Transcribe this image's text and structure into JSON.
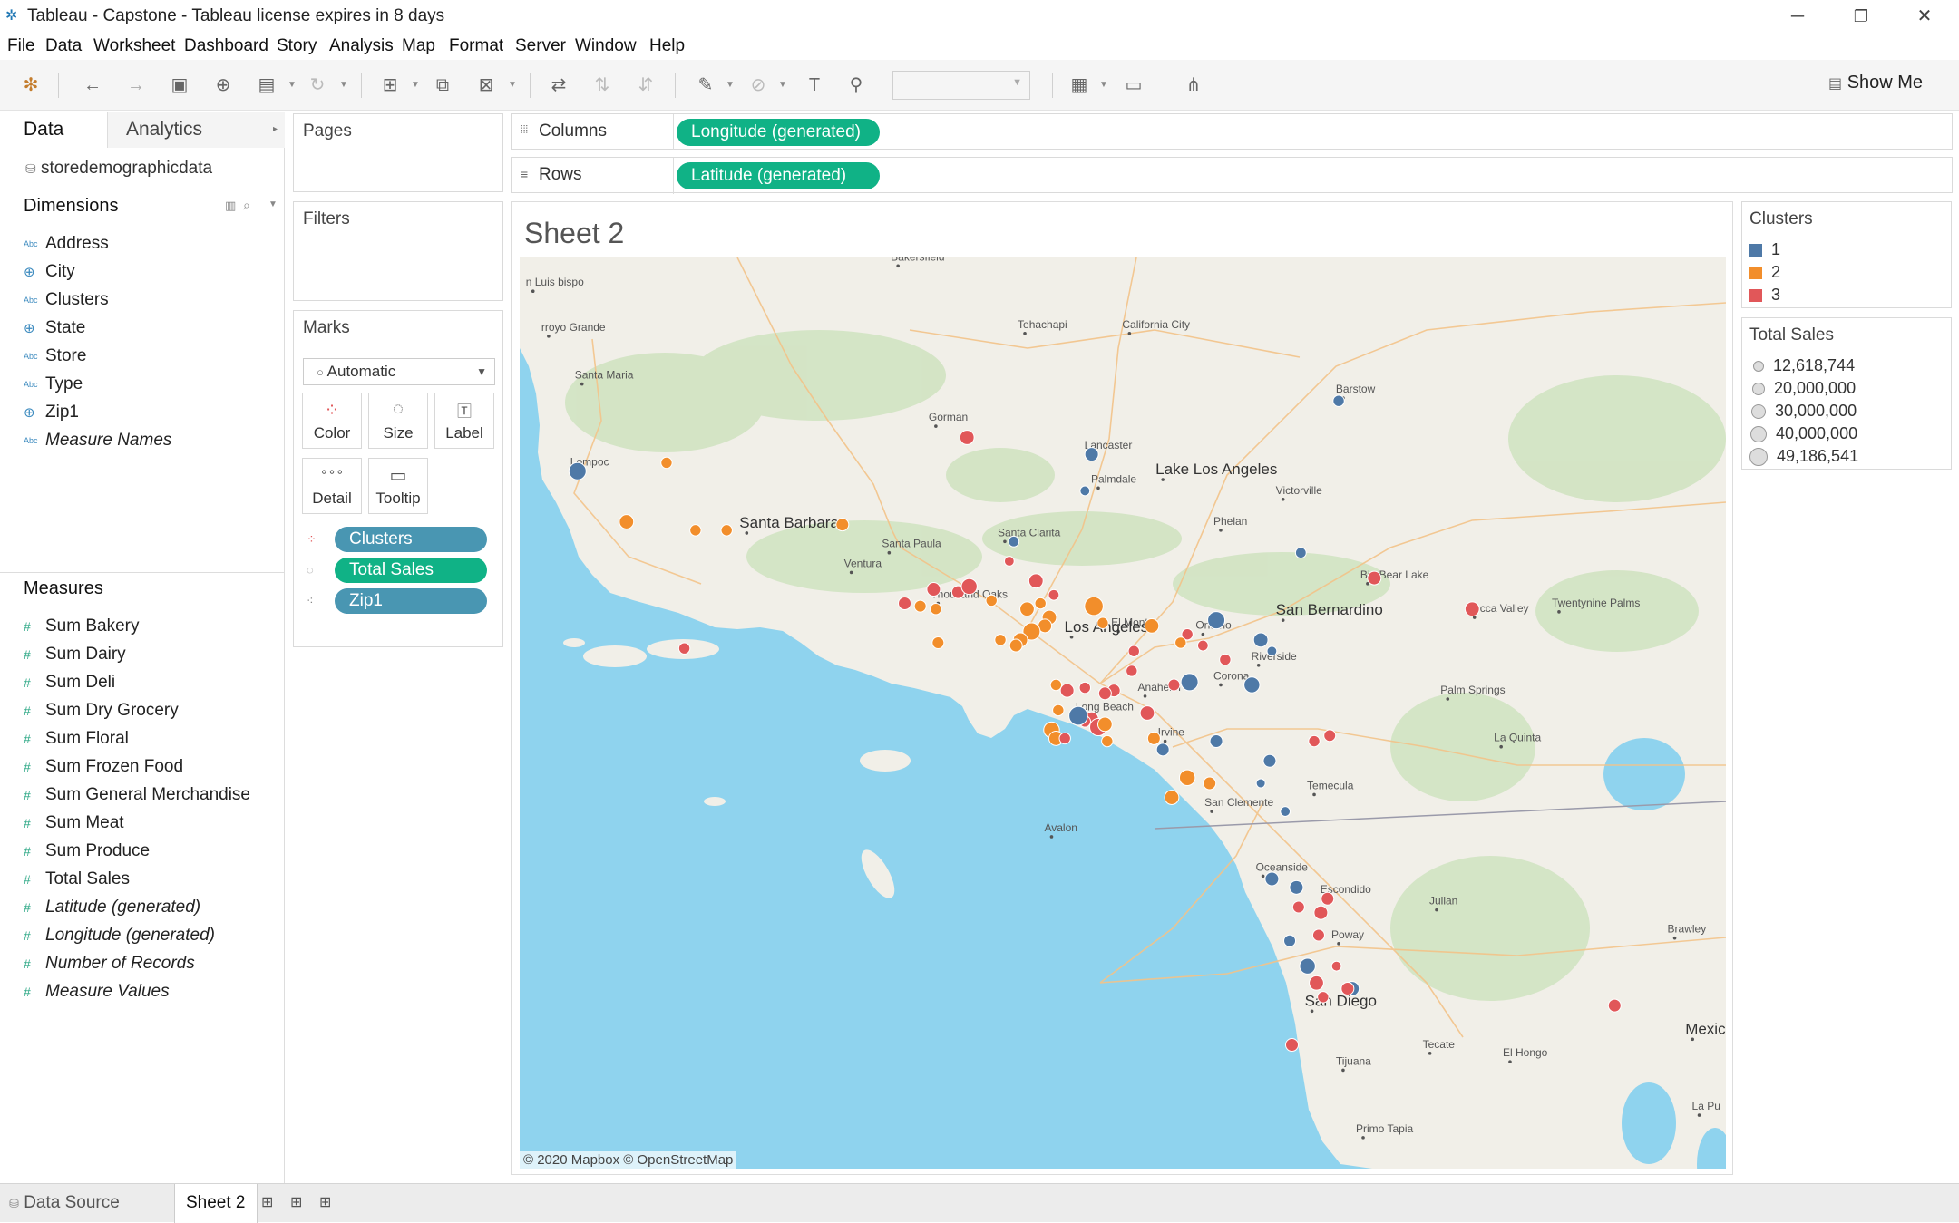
{
  "window": {
    "title": "Tableau - Capstone - Tableau license expires in 8 days",
    "minimize": "─",
    "restore": "❐",
    "close": "✕"
  },
  "menu": [
    "File",
    "Data",
    "Worksheet",
    "Dashboard",
    "Story",
    "Analysis",
    "Map",
    "Format",
    "Server",
    "Window",
    "Help"
  ],
  "toolbar": {
    "show_me": "Show Me"
  },
  "data_pane": {
    "tabs": {
      "data": "Data",
      "analytics": "Analytics"
    },
    "datasource": "storedemographicdata",
    "dimensions_title": "Dimensions",
    "dimensions": [
      {
        "name": "Address",
        "type": "abc",
        "italic": false
      },
      {
        "name": "City",
        "type": "geo",
        "italic": false
      },
      {
        "name": "Clusters",
        "type": "abc",
        "italic": false
      },
      {
        "name": "State",
        "type": "geo",
        "italic": false
      },
      {
        "name": "Store",
        "type": "abc",
        "italic": false
      },
      {
        "name": "Type",
        "type": "abc",
        "italic": false
      },
      {
        "name": "Zip1",
        "type": "geo",
        "italic": false
      },
      {
        "name": "Measure Names",
        "type": "abc",
        "italic": true
      }
    ],
    "measures_title": "Measures",
    "measures": [
      {
        "name": "Sum Bakery",
        "italic": false
      },
      {
        "name": "Sum Dairy",
        "italic": false
      },
      {
        "name": "Sum Deli",
        "italic": false
      },
      {
        "name": "Sum Dry Grocery",
        "italic": false
      },
      {
        "name": "Sum Floral",
        "italic": false
      },
      {
        "name": "Sum Frozen Food",
        "italic": false
      },
      {
        "name": "Sum General Merchandise",
        "italic": false
      },
      {
        "name": "Sum Meat",
        "italic": false
      },
      {
        "name": "Sum Produce",
        "italic": false
      },
      {
        "name": "Total Sales",
        "italic": false
      },
      {
        "name": "Latitude (generated)",
        "italic": true
      },
      {
        "name": "Longitude (generated)",
        "italic": true
      },
      {
        "name": "Number of Records",
        "italic": true
      },
      {
        "name": "Measure Values",
        "italic": true
      }
    ]
  },
  "cards": {
    "pages": "Pages",
    "filters": "Filters",
    "marks": "Marks",
    "mark_type": "Automatic",
    "mark_buttons": [
      "Color",
      "Size",
      "Label",
      "Detail",
      "Tooltip"
    ],
    "mark_pills": [
      "Clusters",
      "Total Sales",
      "Zip1"
    ]
  },
  "shelves": {
    "columns_label": "Columns",
    "columns_pill": "Longitude (generated)",
    "rows_label": "Rows",
    "rows_pill": "Latitude (generated)"
  },
  "sheet": {
    "title": "Sheet 2"
  },
  "map": {
    "attribution": "© 2020 Mapbox © OpenStreetMap",
    "ocean_color": "#8fd3ee",
    "land_color": "#f1efe8",
    "places": [
      {
        "name": "Bakersfield",
        "lon": -119.02,
        "lat": 35.37
      },
      {
        "name": "Tehachapi",
        "lon": -118.45,
        "lat": 35.13
      },
      {
        "name": "California City",
        "lon": -117.98,
        "lat": 35.13
      },
      {
        "name": "Santa Maria",
        "lon": -120.44,
        "lat": 34.95
      },
      {
        "name": "Lompoc",
        "lon": -120.46,
        "lat": 34.64
      },
      {
        "name": "Gorman",
        "lon": -118.85,
        "lat": 34.8
      },
      {
        "name": "Lancaster",
        "lon": -118.15,
        "lat": 34.7
      },
      {
        "name": "Palmdale",
        "lon": -118.12,
        "lat": 34.58
      },
      {
        "name": "Lake Los Angeles",
        "lon": -117.83,
        "lat": 34.61
      },
      {
        "name": "Victorville",
        "lon": -117.29,
        "lat": 34.54
      },
      {
        "name": "Barstow",
        "lon": -117.02,
        "lat": 34.9
      },
      {
        "name": "Santa Barbara",
        "lon": -119.7,
        "lat": 34.42
      },
      {
        "name": "Santa Paula",
        "lon": -119.06,
        "lat": 34.35
      },
      {
        "name": "Ventura",
        "lon": -119.23,
        "lat": 34.28
      },
      {
        "name": "Santa Clarita",
        "lon": -118.54,
        "lat": 34.39
      },
      {
        "name": "Phelan",
        "lon": -117.57,
        "lat": 34.43
      },
      {
        "name": "Big Bear Lake",
        "lon": -116.91,
        "lat": 34.24
      },
      {
        "name": "Yucca Valley",
        "lon": -116.43,
        "lat": 34.12
      },
      {
        "name": "Twentynine Palms",
        "lon": -116.05,
        "lat": 34.14
      },
      {
        "name": "Thousand Oaks",
        "lon": -118.84,
        "lat": 34.17
      },
      {
        "name": "El Monte",
        "lon": -118.03,
        "lat": 34.07
      },
      {
        "name": "Ontario",
        "lon": -117.65,
        "lat": 34.06
      },
      {
        "name": "San Bernardino",
        "lon": -117.29,
        "lat": 34.11
      },
      {
        "name": "Los Angeles",
        "lon": -118.24,
        "lat": 34.05
      },
      {
        "name": "Riverside",
        "lon": -117.4,
        "lat": 33.95
      },
      {
        "name": "Anaheim",
        "lon": -117.91,
        "lat": 33.84
      },
      {
        "name": "Corona",
        "lon": -117.57,
        "lat": 33.88
      },
      {
        "name": "Palm Springs",
        "lon": -116.55,
        "lat": 33.83
      },
      {
        "name": "Long Beach",
        "lon": -118.19,
        "lat": 33.77
      },
      {
        "name": "Irvine",
        "lon": -117.82,
        "lat": 33.68
      },
      {
        "name": "La Quinta",
        "lon": -116.31,
        "lat": 33.66
      },
      {
        "name": "Temecula",
        "lon": -117.15,
        "lat": 33.49
      },
      {
        "name": "San Clemente",
        "lon": -117.61,
        "lat": 33.43
      },
      {
        "name": "Avalon",
        "lon": -118.33,
        "lat": 33.34
      },
      {
        "name": "Oceanside",
        "lon": -117.38,
        "lat": 33.2
      },
      {
        "name": "Escondido",
        "lon": -117.09,
        "lat": 33.12
      },
      {
        "name": "Julian",
        "lon": -116.6,
        "lat": 33.08
      },
      {
        "name": "Poway",
        "lon": -117.04,
        "lat": 32.96
      },
      {
        "name": "Brawley",
        "lon": -115.53,
        "lat": 32.98
      },
      {
        "name": "San Diego",
        "lon": -117.16,
        "lat": 32.72
      },
      {
        "name": "Tecate",
        "lon": -116.63,
        "lat": 32.57
      },
      {
        "name": "El Hongo",
        "lon": -116.27,
        "lat": 32.54
      },
      {
        "name": "Mexicali",
        "lon": -115.45,
        "lat": 32.62
      },
      {
        "name": "Tijuana",
        "lon": -117.02,
        "lat": 32.51
      },
      {
        "name": "Primo Tapia",
        "lon": -116.93,
        "lat": 32.27
      },
      {
        "name": "n Luis\nbispo",
        "lon": -120.66,
        "lat": 35.28
      },
      {
        "name": "rroyo Grande",
        "lon": -120.59,
        "lat": 35.12
      },
      {
        "name": "La Pu",
        "lon": -115.42,
        "lat": 32.35
      }
    ],
    "stores": [
      {
        "lon": -120.46,
        "lat": 34.64,
        "cluster": 1,
        "sales": 40000000
      },
      {
        "lon": -120.06,
        "lat": 34.67,
        "cluster": 2,
        "sales": 20000000
      },
      {
        "lon": -120.24,
        "lat": 34.46,
        "cluster": 2,
        "sales": 30000000
      },
      {
        "lon": -119.93,
        "lat": 34.43,
        "cluster": 2,
        "sales": 20000000
      },
      {
        "lon": -119.79,
        "lat": 34.43,
        "cluster": 2,
        "sales": 20000000
      },
      {
        "lon": -119.27,
        "lat": 34.45,
        "cluster": 2,
        "sales": 25000000
      },
      {
        "lon": -119.98,
        "lat": 34.01,
        "cluster": 3,
        "sales": 20000000
      },
      {
        "lon": -118.71,
        "lat": 34.76,
        "cluster": 3,
        "sales": 30000000
      },
      {
        "lon": -118.15,
        "lat": 34.7,
        "cluster": 1,
        "sales": 28000000
      },
      {
        "lon": -118.18,
        "lat": 34.57,
        "cluster": 1,
        "sales": 15000000
      },
      {
        "lon": -117.04,
        "lat": 34.89,
        "cluster": 1,
        "sales": 20000000
      },
      {
        "lon": -118.5,
        "lat": 34.39,
        "cluster": 1,
        "sales": 18000000
      },
      {
        "lon": -118.52,
        "lat": 34.32,
        "cluster": 3,
        "sales": 15000000
      },
      {
        "lon": -118.86,
        "lat": 34.22,
        "cluster": 3,
        "sales": 28000000
      },
      {
        "lon": -118.75,
        "lat": 34.21,
        "cluster": 3,
        "sales": 25000000
      },
      {
        "lon": -118.7,
        "lat": 34.23,
        "cluster": 3,
        "sales": 35000000
      },
      {
        "lon": -118.6,
        "lat": 34.18,
        "cluster": 2,
        "sales": 20000000
      },
      {
        "lon": -118.99,
        "lat": 34.17,
        "cluster": 3,
        "sales": 25000000
      },
      {
        "lon": -118.92,
        "lat": 34.16,
        "cluster": 2,
        "sales": 22000000
      },
      {
        "lon": -118.85,
        "lat": 34.15,
        "cluster": 2,
        "sales": 20000000
      },
      {
        "lon": -118.4,
        "lat": 34.25,
        "cluster": 3,
        "sales": 30000000
      },
      {
        "lon": -118.44,
        "lat": 34.15,
        "cluster": 2,
        "sales": 30000000
      },
      {
        "lon": -118.38,
        "lat": 34.17,
        "cluster": 2,
        "sales": 20000000
      },
      {
        "lon": -118.34,
        "lat": 34.12,
        "cluster": 2,
        "sales": 30000000
      },
      {
        "lon": -118.36,
        "lat": 34.09,
        "cluster": 2,
        "sales": 28000000
      },
      {
        "lon": -118.42,
        "lat": 34.07,
        "cluster": 2,
        "sales": 40000000
      },
      {
        "lon": -118.47,
        "lat": 34.04,
        "cluster": 2,
        "sales": 30000000
      },
      {
        "lon": -118.49,
        "lat": 34.02,
        "cluster": 2,
        "sales": 25000000
      },
      {
        "lon": -118.56,
        "lat": 34.04,
        "cluster": 2,
        "sales": 20000000
      },
      {
        "lon": -118.84,
        "lat": 34.03,
        "cluster": 2,
        "sales": 22000000
      },
      {
        "lon": -118.14,
        "lat": 34.16,
        "cluster": 2,
        "sales": 45000000
      },
      {
        "lon": -118.1,
        "lat": 34.1,
        "cluster": 2,
        "sales": 20000000
      },
      {
        "lon": -117.88,
        "lat": 34.09,
        "cluster": 2,
        "sales": 30000000
      },
      {
        "lon": -117.96,
        "lat": 34.0,
        "cluster": 3,
        "sales": 20000000
      },
      {
        "lon": -117.72,
        "lat": 34.06,
        "cluster": 3,
        "sales": 20000000
      },
      {
        "lon": -117.59,
        "lat": 34.11,
        "cluster": 1,
        "sales": 40000000
      },
      {
        "lon": -117.39,
        "lat": 34.04,
        "cluster": 1,
        "sales": 30000000
      },
      {
        "lon": -117.34,
        "lat": 34.0,
        "cluster": 1,
        "sales": 15000000
      },
      {
        "lon": -117.55,
        "lat": 33.97,
        "cluster": 3,
        "sales": 20000000
      },
      {
        "lon": -117.71,
        "lat": 33.89,
        "cluster": 1,
        "sales": 40000000
      },
      {
        "lon": -117.43,
        "lat": 33.88,
        "cluster": 1,
        "sales": 35000000
      },
      {
        "lon": -118.31,
        "lat": 33.88,
        "cluster": 2,
        "sales": 20000000
      },
      {
        "lon": -118.26,
        "lat": 33.86,
        "cluster": 3,
        "sales": 28000000
      },
      {
        "lon": -118.18,
        "lat": 33.87,
        "cluster": 3,
        "sales": 20000000
      },
      {
        "lon": -118.05,
        "lat": 33.86,
        "cluster": 3,
        "sales": 25000000
      },
      {
        "lon": -118.09,
        "lat": 33.85,
        "cluster": 3,
        "sales": 25000000
      },
      {
        "lon": -117.9,
        "lat": 33.78,
        "cluster": 3,
        "sales": 30000000
      },
      {
        "lon": -118.15,
        "lat": 33.76,
        "cluster": 3,
        "sales": 28000000
      },
      {
        "lon": -118.18,
        "lat": 33.75,
        "cluster": 3,
        "sales": 20000000
      },
      {
        "lon": -118.21,
        "lat": 33.77,
        "cluster": 1,
        "sales": 45000000
      },
      {
        "lon": -118.12,
        "lat": 33.73,
        "cluster": 3,
        "sales": 40000000
      },
      {
        "lon": -118.09,
        "lat": 33.74,
        "cluster": 2,
        "sales": 30000000
      },
      {
        "lon": -118.3,
        "lat": 33.79,
        "cluster": 2,
        "sales": 20000000
      },
      {
        "lon": -118.33,
        "lat": 33.72,
        "cluster": 2,
        "sales": 35000000
      },
      {
        "lon": -118.31,
        "lat": 33.69,
        "cluster": 2,
        "sales": 30000000
      },
      {
        "lon": -118.27,
        "lat": 33.69,
        "cluster": 3,
        "sales": 20000000
      },
      {
        "lon": -118.08,
        "lat": 33.68,
        "cluster": 2,
        "sales": 20000000
      },
      {
        "lon": -117.87,
        "lat": 33.69,
        "cluster": 2,
        "sales": 25000000
      },
      {
        "lon": -117.83,
        "lat": 33.65,
        "cluster": 1,
        "sales": 25000000
      },
      {
        "lon": -117.59,
        "lat": 33.68,
        "cluster": 1,
        "sales": 25000000
      },
      {
        "lon": -117.72,
        "lat": 33.55,
        "cluster": 2,
        "sales": 35000000
      },
      {
        "lon": -117.79,
        "lat": 33.48,
        "cluster": 2,
        "sales": 30000000
      },
      {
        "lon": -117.62,
        "lat": 33.53,
        "cluster": 2,
        "sales": 25000000
      },
      {
        "lon": -117.35,
        "lat": 33.61,
        "cluster": 1,
        "sales": 25000000
      },
      {
        "lon": -117.15,
        "lat": 33.68,
        "cluster": 3,
        "sales": 20000000
      },
      {
        "lon": -117.28,
        "lat": 33.43,
        "cluster": 1,
        "sales": 15000000
      },
      {
        "lon": -117.34,
        "lat": 33.19,
        "cluster": 1,
        "sales": 28000000
      },
      {
        "lon": -117.23,
        "lat": 33.16,
        "cluster": 1,
        "sales": 28000000
      },
      {
        "lon": -117.09,
        "lat": 33.12,
        "cluster": 3,
        "sales": 25000000
      },
      {
        "lon": -117.22,
        "lat": 33.09,
        "cluster": 3,
        "sales": 22000000
      },
      {
        "lon": -117.12,
        "lat": 33.07,
        "cluster": 3,
        "sales": 28000000
      },
      {
        "lon": -117.13,
        "lat": 32.99,
        "cluster": 3,
        "sales": 22000000
      },
      {
        "lon": -117.26,
        "lat": 32.97,
        "cluster": 1,
        "sales": 22000000
      },
      {
        "lon": -117.18,
        "lat": 32.88,
        "cluster": 1,
        "sales": 35000000
      },
      {
        "lon": -117.14,
        "lat": 32.82,
        "cluster": 3,
        "sales": 30000000
      },
      {
        "lon": -117.11,
        "lat": 32.77,
        "cluster": 3,
        "sales": 20000000
      },
      {
        "lon": -117.05,
        "lat": 32.88,
        "cluster": 3,
        "sales": 15000000
      },
      {
        "lon": -116.98,
        "lat": 32.8,
        "cluster": 1,
        "sales": 30000000
      },
      {
        "lon": -117.0,
        "lat": 32.8,
        "cluster": 3,
        "sales": 25000000
      },
      {
        "lon": -117.25,
        "lat": 32.6,
        "cluster": 3,
        "sales": 25000000
      },
      {
        "lon": -117.75,
        "lat": 34.03,
        "cluster": 2,
        "sales": 20000000
      },
      {
        "lon": -116.88,
        "lat": 34.26,
        "cluster": 3,
        "sales": 28000000
      },
      {
        "lon": -116.44,
        "lat": 34.15,
        "cluster": 3,
        "sales": 30000000
      },
      {
        "lon": -117.21,
        "lat": 34.35,
        "cluster": 1,
        "sales": 18000000
      },
      {
        "lon": -117.08,
        "lat": 33.7,
        "cluster": 3,
        "sales": 22000000
      },
      {
        "lon": -115.8,
        "lat": 32.74,
        "cluster": 3,
        "sales": 25000000
      },
      {
        "lon": -117.78,
        "lat": 33.88,
        "cluster": 3,
        "sales": 22000000
      },
      {
        "lon": -117.65,
        "lat": 34.02,
        "cluster": 3,
        "sales": 18000000
      },
      {
        "lon": -117.39,
        "lat": 33.53,
        "cluster": 1,
        "sales": 12618744
      },
      {
        "lon": -118.32,
        "lat": 34.2,
        "cluster": 3,
        "sales": 18000000
      },
      {
        "lon": -117.97,
        "lat": 33.93,
        "cluster": 3,
        "sales": 20000000
      }
    ]
  },
  "legends": {
    "clusters_title": "Clusters",
    "clusters": [
      {
        "label": "1",
        "color": "#4e79a7"
      },
      {
        "label": "2",
        "color": "#f28e2b"
      },
      {
        "label": "3",
        "color": "#e15759"
      }
    ],
    "sales_title": "Total Sales",
    "sales": [
      {
        "label": "12,618,744",
        "value": 12618744
      },
      {
        "label": "20,000,000",
        "value": 20000000
      },
      {
        "label": "30,000,000",
        "value": 30000000
      },
      {
        "label": "40,000,000",
        "value": 40000000
      },
      {
        "label": "49,186,541",
        "value": 49186541
      }
    ]
  },
  "bottom_tabs": {
    "data_source": "Data Source",
    "sheet": "Sheet 2"
  }
}
